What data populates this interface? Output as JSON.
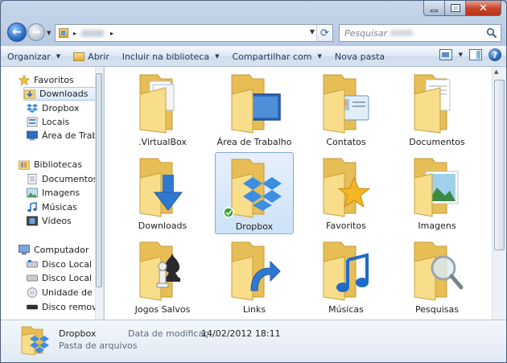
{
  "window": {
    "caption": {
      "minimize": "–",
      "maximize": "□",
      "close": "✕"
    }
  },
  "navigation": {
    "back_icon": "back-arrow-icon",
    "forward_icon": "forward-arrow-icon",
    "address_separator": "▸",
    "search_placeholder": "Pesquisar"
  },
  "toolbar": {
    "organize": "Organizar",
    "open": "Abrir",
    "include_library": "Incluir na biblioteca",
    "share": "Compartilhar com",
    "new_folder": "Nova pasta",
    "help": "?"
  },
  "sidebar": {
    "favorites_header": "Favoritos",
    "favorites": [
      {
        "label": "Downloads",
        "icon": "downloads-icon"
      },
      {
        "label": "Dropbox",
        "icon": "dropbox-icon"
      },
      {
        "label": "Locais",
        "icon": "places-icon"
      },
      {
        "label": "Área de Trabalho",
        "icon": "desktop-icon"
      }
    ],
    "libraries_header": "Bibliotecas",
    "libraries": [
      {
        "label": "Documentos",
        "icon": "documents-icon"
      },
      {
        "label": "Imagens",
        "icon": "pictures-icon"
      },
      {
        "label": "Músicas",
        "icon": "music-icon"
      },
      {
        "label": "Vídeos",
        "icon": "videos-icon"
      }
    ],
    "computer_header": "Computador",
    "computer": [
      {
        "label": "Disco Local (C:)",
        "icon": "drive-icon"
      },
      {
        "label": "Disco Local (D:)",
        "icon": "drive-icon"
      },
      {
        "label": "Unidade de BD-R",
        "icon": "optical-drive-icon"
      },
      {
        "label": "Disco removível (",
        "icon": "removable-drive-icon"
      }
    ]
  },
  "folders": [
    {
      "label": ".VirtualBox",
      "icon": "virtualbox-folder-icon"
    },
    {
      "label": "Área de Trabalho",
      "icon": "desktop-folder-icon"
    },
    {
      "label": "Contatos",
      "icon": "contacts-folder-icon"
    },
    {
      "label": "Documentos",
      "icon": "documents-folder-icon"
    },
    {
      "label": "Downloads",
      "icon": "downloads-folder-icon"
    },
    {
      "label": "Dropbox",
      "icon": "dropbox-folder-icon",
      "selected": true
    },
    {
      "label": "Favoritos",
      "icon": "favorites-folder-icon"
    },
    {
      "label": "Imagens",
      "icon": "pictures-folder-icon"
    },
    {
      "label": "Jogos Salvos",
      "icon": "saved-games-folder-icon"
    },
    {
      "label": "Links",
      "icon": "links-folder-icon"
    },
    {
      "label": "Músicas",
      "icon": "music-folder-icon"
    },
    {
      "label": "Pesquisas",
      "icon": "searches-folder-icon"
    }
  ],
  "details": {
    "name": "Dropbox",
    "type": "Pasta de arquivos",
    "modified_label": "Data de modificaç...",
    "modified_value": "14/02/2012 18:11"
  },
  "colors": {
    "folder_front": "#f8dd8a",
    "folder_back": "#e7bd55",
    "selection": "#cde2f8",
    "accent_blue": "#2a6cc4"
  }
}
